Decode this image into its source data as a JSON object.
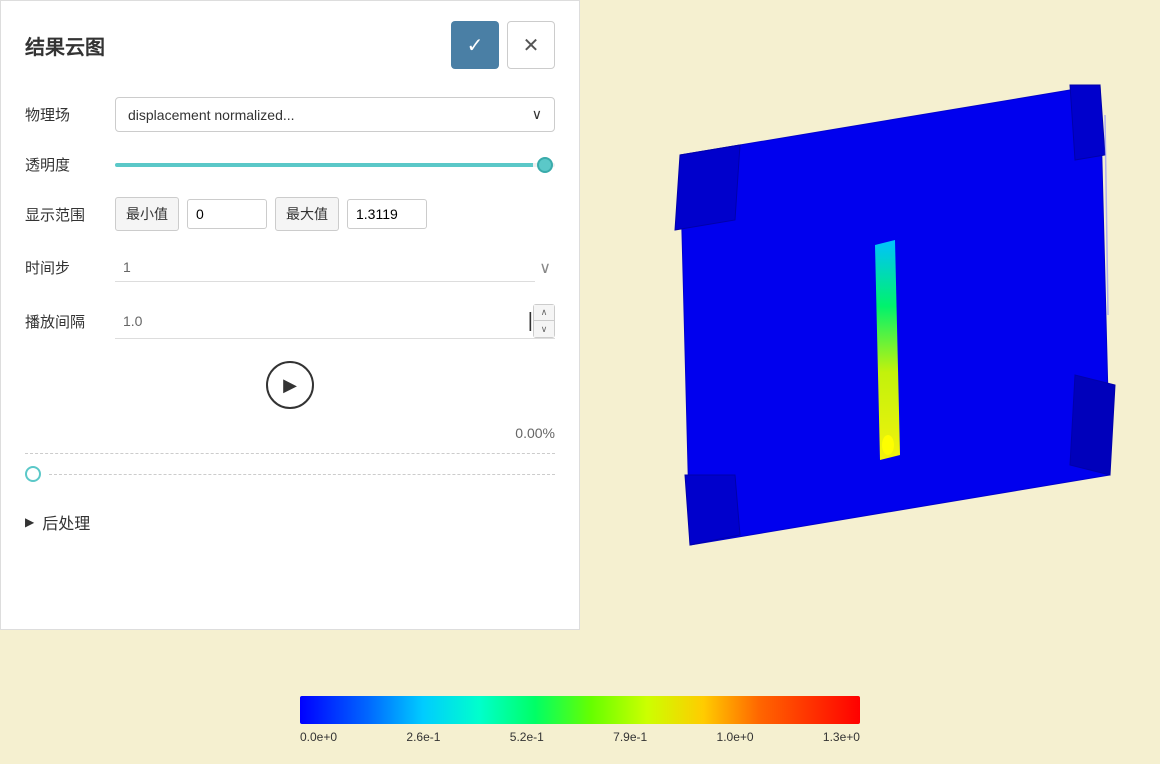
{
  "panel": {
    "title": "结果云图",
    "confirm_label": "✓",
    "cancel_label": "✕"
  },
  "form": {
    "physics_field_label": "物理场",
    "physics_field_value": "displacement normalized...",
    "transparency_label": "透明度",
    "display_range_label": "显示范围",
    "min_label": "最小值",
    "min_value": "0",
    "max_label": "最大值",
    "max_value": "1.3119",
    "timestep_label": "时间步",
    "timestep_value": "1",
    "interval_label": "播放间隔",
    "interval_value": "1.0",
    "progress_value": "0.00%"
  },
  "post_processing": {
    "label": "后处理"
  },
  "colorbar": {
    "labels": [
      "0.0e+0",
      "2.6e-1",
      "5.2e-1",
      "7.9e-1",
      "1.0e+0",
      "1.3e+0"
    ]
  },
  "icons": {
    "check": "✓",
    "close": "✕",
    "dropdown_arrow": "∨",
    "play": "▶",
    "spinner_up": "∧",
    "spinner_down": "∨",
    "arrow_right": "▶"
  }
}
